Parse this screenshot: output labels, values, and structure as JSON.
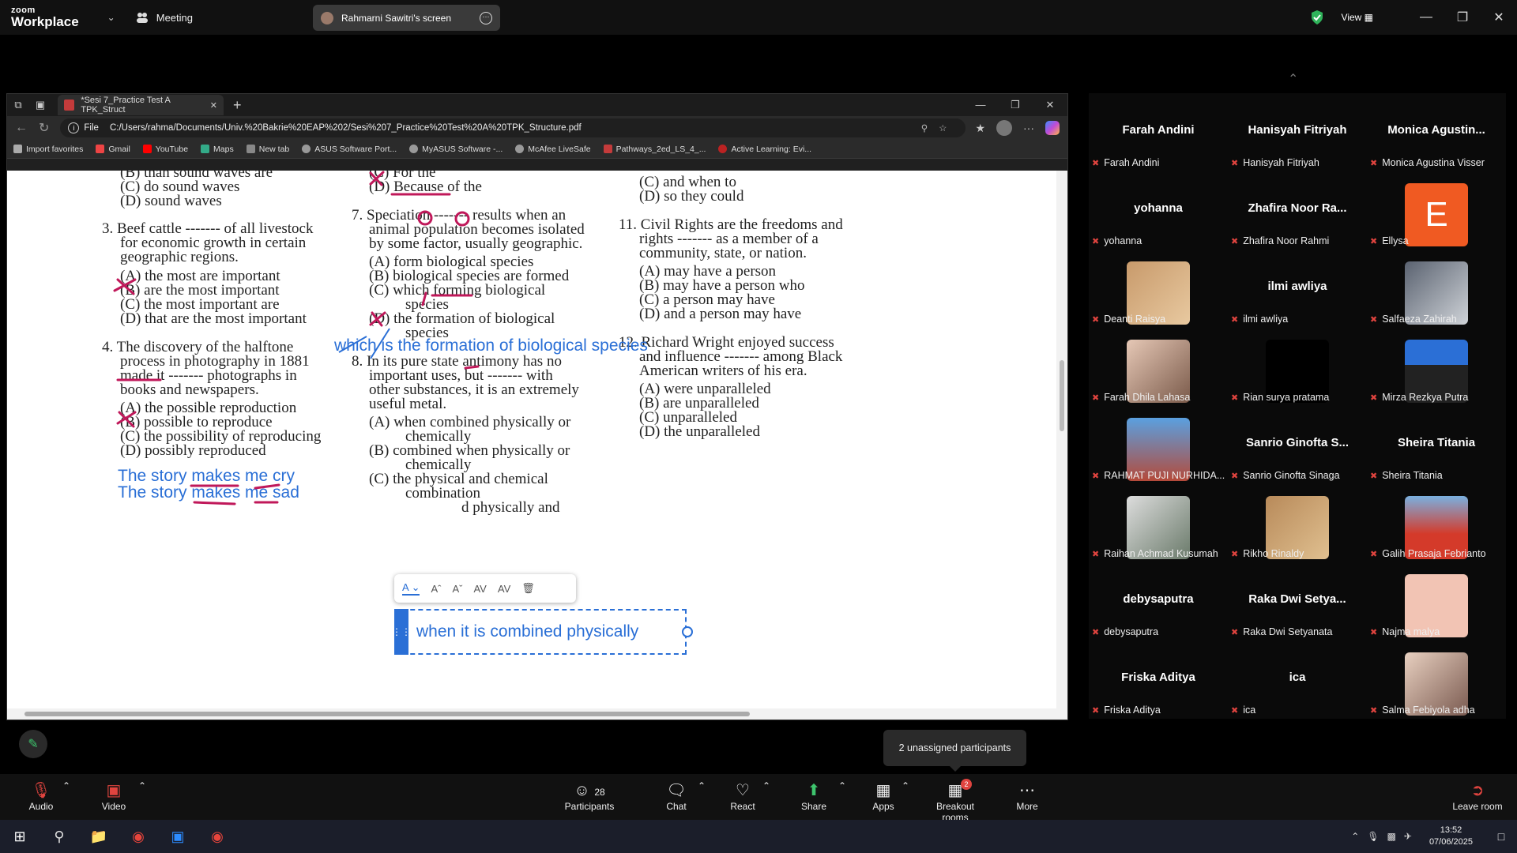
{
  "zoom": {
    "logo_top": "zoom",
    "logo_bottom": "Workplace",
    "meeting_label": "Meeting",
    "screen_label": "Rahmarni Sawitri's screen",
    "view_label": "View"
  },
  "browser": {
    "tab_title": "*Sesi 7_Practice Test A TPK_Struct",
    "url_prefix": "File",
    "url": "C:/Users/rahma/Documents/Univ.%20Bakrie%20EAP%202/Sesi%207_Practice%20Test%20A%20TPK_Structure.pdf",
    "bookmarks": [
      "Import favorites",
      "Gmail",
      "YouTube",
      "Maps",
      "New tab",
      "ASUS Software Port...",
      "MyASUS Software -...",
      "McAfee LiveSafe",
      "Pathways_2ed_LS_4_...",
      "Active Learning: Evi..."
    ]
  },
  "pdf": {
    "col1": [
      "(B)  than sound waves are",
      "(C)  do sound waves",
      "(D)  sound waves",
      "3.  Beef cattle ------- of all livestock",
      "for economic growth in certain",
      "geographic regions.",
      "(A)  the most are important",
      "(B)  are the most important",
      "(C)  the most important are",
      "(D)  that are the most important",
      "4.  The discovery of the halftone",
      "process in photography in 1881",
      "made it ------- photographs in",
      "books and newspapers.",
      "(A)  the possible reproduction",
      "(B)  possible to reproduce",
      "(C)  the possibility of reproducing",
      "(D)  possibly reproduced"
    ],
    "col2": [
      "(C)  For the",
      "(D)  Because of the",
      "7.  Speciation ------- results when an",
      "animal population becomes isolated",
      "by some factor, usually geographic.",
      "(A)  form biological species",
      "(B)  biological species are formed",
      "(C)  which forming biological",
      "species",
      "(D)  the formation of biological",
      "species",
      "8.  In its pure state antimony has no",
      "important uses, but ------- with",
      "other substances, it is an extremely",
      "useful metal.",
      "(A)  when combined physically or",
      "chemically",
      "(B)  combined when physically or",
      "chemically",
      "(C)  the physical and chemical",
      "combination",
      "d physically and"
    ],
    "col3": [
      "(C)  and when to",
      "(D)  so they could",
      "11.  Civil Rights are the freedoms and",
      "rights ------- as a member of a",
      "community, state, or nation.",
      "(A)  may have a person",
      "(B)  may have a person who",
      "(C)  a person may have",
      "(D)  and a person may have",
      "12.  Richard Wright enjoyed success",
      "and influence ------- among Black",
      "American writers of his era.",
      "(A)  were unparalleled",
      "(B)  are unparalleled",
      "(C)  unparalleled",
      "(D)  the unparalleled"
    ],
    "notes": [
      "The story makes me cry",
      "The story makes me sad",
      "which is the formation of biological species"
    ],
    "textbox_value": "when it is combined physically"
  },
  "participants": [
    {
      "name": "Farah Andini",
      "label": "Farah Andini"
    },
    {
      "name": "Hanisyah Fitriyah",
      "label": "Hanisyah Fitriyah"
    },
    {
      "name": "Monica  Agustin...",
      "label": "Monica Agustina Visser"
    },
    {
      "name": "yohanna",
      "label": "yohanna"
    },
    {
      "name": "Zhafira Noor Ra...",
      "label": "Zhafira Noor Rahmi"
    },
    {
      "name": "",
      "label": "Ellysa",
      "initial": "E"
    },
    {
      "name": "",
      "label": "Deanti Raisya"
    },
    {
      "name": "ilmi awliya",
      "label": "ilmi awliya"
    },
    {
      "name": "",
      "label": "Salfaeza Zahirah"
    },
    {
      "name": "",
      "label": "Farah Dhila Lahasa"
    },
    {
      "name": "",
      "label": "Rian surya pratama"
    },
    {
      "name": "",
      "label": "Mirza Rezkya Putra"
    },
    {
      "name": "",
      "label": "RAHMAT PUJI NURHIDA..."
    },
    {
      "name": "Sanrio  Ginofta  S...",
      "label": "Sanrio Ginofta Sinaga"
    },
    {
      "name": "Sheira Titania",
      "label": "Sheira Titania"
    },
    {
      "name": "",
      "label": "Raihan Achmad Kusumah"
    },
    {
      "name": "",
      "label": "Rikho Rinaldy"
    },
    {
      "name": "",
      "label": "Galih Prasaja Febrianto"
    },
    {
      "name": "debysaputra",
      "label": "debysaputra"
    },
    {
      "name": "Raka  Dwi  Setya...",
      "label": "Raka Dwi Setyanata"
    },
    {
      "name": "",
      "label": "Najma malya"
    },
    {
      "name": "Friska Aditya",
      "label": "Friska Aditya"
    },
    {
      "name": "ica",
      "label": "ica"
    },
    {
      "name": "",
      "label": "Salma Febiyola adha"
    }
  ],
  "unassigned": "2 unassigned participants",
  "controls": {
    "audio": "Audio",
    "video": "Video",
    "participants": "Participants",
    "participant_count": "28",
    "chat": "Chat",
    "react": "React",
    "share": "Share",
    "apps": "Apps",
    "breakout": "Breakout rooms",
    "breakout_badge": "2",
    "more": "More",
    "leave": "Leave room"
  },
  "taskbar": {
    "time": "13:52",
    "date": "07/06/2025"
  }
}
